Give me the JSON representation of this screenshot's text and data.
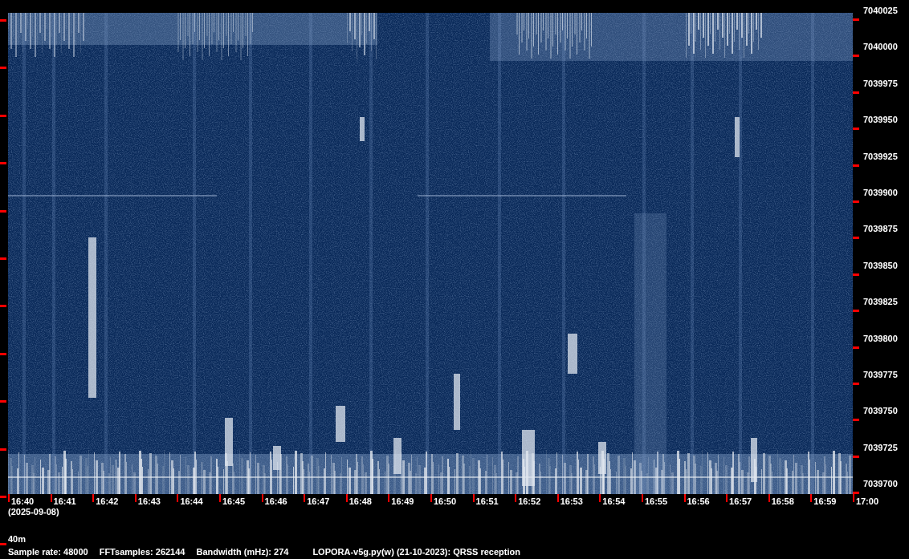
{
  "frequency_axis": {
    "labels": [
      "7040025",
      "7040000",
      "7039975",
      "7039950",
      "7039925",
      "7039900",
      "7039875",
      "7039850",
      "7039825",
      "7039800",
      "7039775",
      "7039750",
      "7039725",
      "7039700"
    ]
  },
  "time_axis": {
    "labels": [
      "16:40",
      "16:41",
      "16:42",
      "16:43",
      "16:44",
      "16:45",
      "16:46",
      "16:47",
      "16:48",
      "16:49",
      "16:50",
      "16:51",
      "16:52",
      "16:53",
      "16:54",
      "16:55",
      "16:56",
      "16:57",
      "16:58",
      "16:59",
      "17:00"
    ],
    "date": "(2025-09-08)"
  },
  "band": "40m",
  "info": [
    "Sample rate: 48000",
    "FFTsamples: 262144",
    "Bandwidth (mHz): 274",
    "LOPORA-v5g.py(w) (21-10-2023): QRSS reception"
  ]
}
